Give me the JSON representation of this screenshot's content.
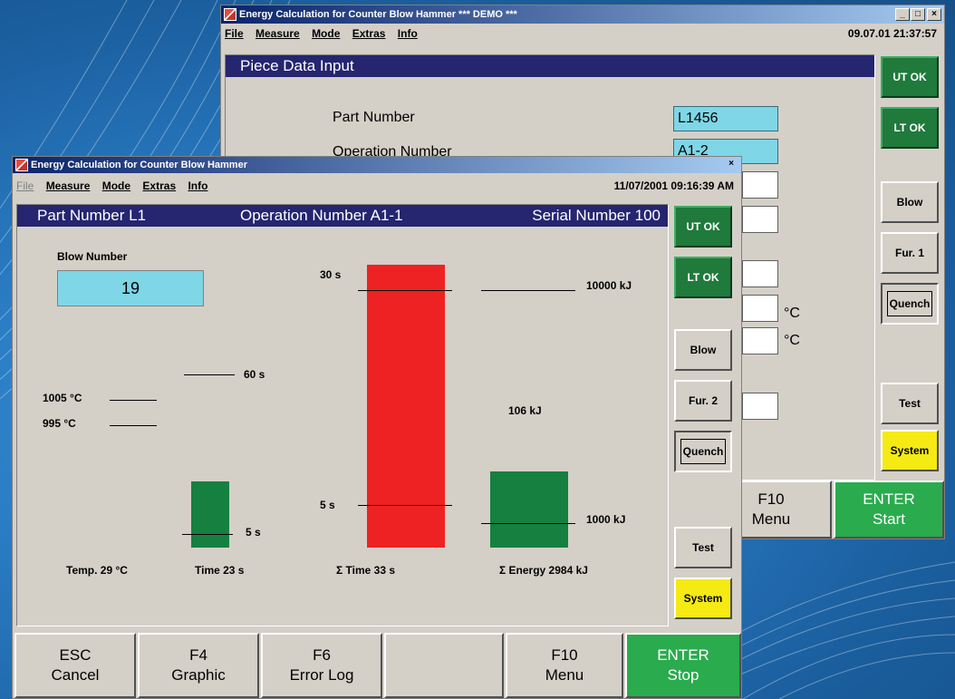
{
  "back_window": {
    "title": "Energy Calculation for Counter Blow Hammer *** DEMO ***",
    "menu": [
      "File",
      "Measure",
      "Mode",
      "Extras",
      "Info"
    ],
    "datetime": "09.07.01 21:37:57",
    "panel_title": "Piece Data Input",
    "fields": [
      {
        "label": "Part Number",
        "value": "L1456"
      },
      {
        "label": "Operation Number",
        "value": "A1-2"
      }
    ],
    "units": [
      "°C",
      "°C"
    ],
    "side_buttons": [
      "UT OK",
      "LT OK",
      "Blow",
      "Fur. 1",
      "Quench",
      "Test",
      "System"
    ],
    "fkeys": [
      {
        "key": "F10",
        "label": "Menu"
      },
      {
        "key": "ENTER",
        "label": "Start"
      }
    ]
  },
  "front_window": {
    "title": "Energy Calculation for Counter Blow Hammer",
    "menu": [
      "File",
      "Measure",
      "Mode",
      "Extras",
      "Info"
    ],
    "datetime": "11/07/2001 09:16:39 AM",
    "header": {
      "part": "Part Number L1",
      "operation": "Operation Number A1-1",
      "serial": "Serial Number 100"
    },
    "blow_number_label": "Blow Number",
    "blow_number": "19",
    "temp": {
      "upper_limit": "1005 °C",
      "lower_limit": "995 °C",
      "caption": "Temp. 29 °C"
    },
    "time": {
      "upper_limit": "60 s",
      "lower_limit": "5 s",
      "caption": "Time 23 s",
      "value": 23
    },
    "sum_time": {
      "upper_limit": "30 s",
      "lower_limit": "5 s",
      "caption": "Σ Time 33 s",
      "value": 33
    },
    "sum_energy": {
      "upper_limit": "10000 kJ",
      "lower_limit": "1000 kJ",
      "last_blow": "106 kJ",
      "caption": "Σ Energy 2984 kJ",
      "value": 2984
    },
    "side_buttons": [
      "UT OK",
      "LT OK",
      "Blow",
      "Fur. 2",
      "Quench",
      "Test",
      "System"
    ],
    "fkeys": [
      {
        "key": "ESC",
        "label": "Cancel"
      },
      {
        "key": "F4",
        "label": "Graphic"
      },
      {
        "key": "F6",
        "label": "Error Log"
      },
      {
        "key": "",
        "label": ""
      },
      {
        "key": "F10",
        "label": "Menu"
      },
      {
        "key": "ENTER",
        "label": "Stop"
      }
    ]
  },
  "colors": {
    "title_active": "#0a246a",
    "header": "#252570",
    "ok_green": "#1f7a3c",
    "enter_green": "#2aab4e",
    "system_yellow": "#f5ea14",
    "bar_red": "#ee2222",
    "bar_green": "#158040",
    "field_cyan": "#7fd6e6"
  },
  "icons": [
    "app-hammer-icon",
    "minimize-icon",
    "maximize-icon",
    "close-icon"
  ]
}
